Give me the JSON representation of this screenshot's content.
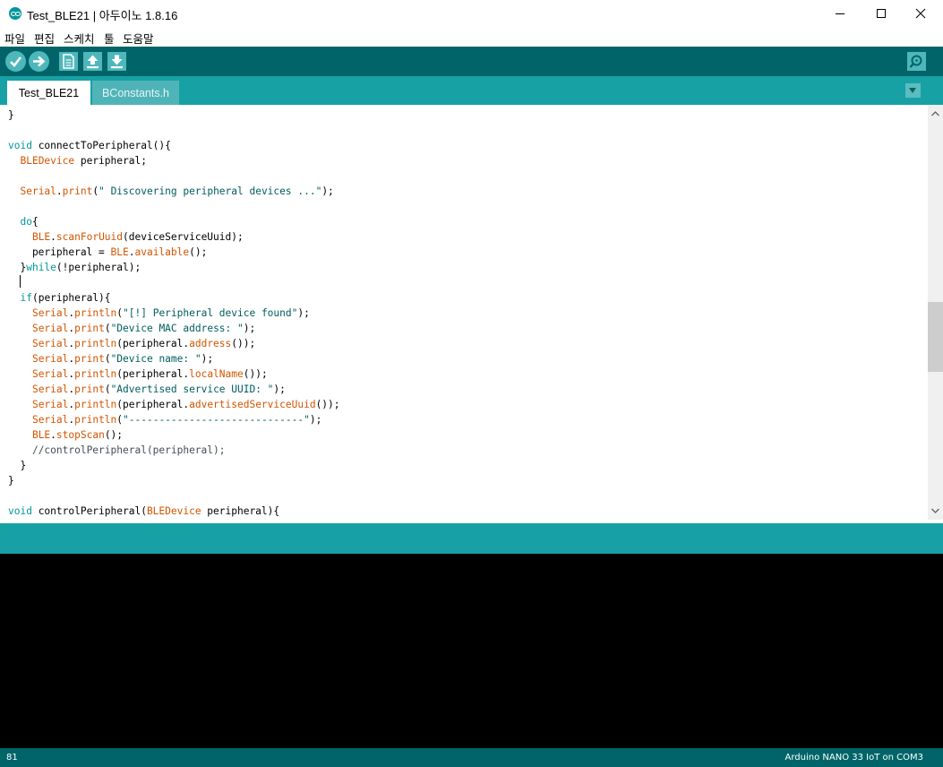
{
  "window": {
    "title": "Test_BLE21 | 아두이노 1.8.16",
    "icons": {
      "app": "arduino-logo-icon",
      "minimize": "minimize-icon",
      "maximize": "maximize-icon",
      "close": "close-icon"
    }
  },
  "menu": {
    "items": [
      "파일",
      "편집",
      "스케치",
      "툴",
      "도움말"
    ]
  },
  "toolbar": {
    "buttons": [
      "verify-icon",
      "upload-icon",
      "new-sketch-icon",
      "open-sketch-icon",
      "save-sketch-icon"
    ],
    "serial_monitor": "serial-monitor-icon"
  },
  "tabs": [
    {
      "label": "Test_BLE21",
      "active": true
    },
    {
      "label": "BConstants.h",
      "active": false
    }
  ],
  "editor": {
    "lines": [
      "}",
      "",
      "void connectToPeripheral(){",
      "  BLEDevice peripheral;",
      "",
      "  Serial.print(\" Discovering peripheral devices ...\");",
      "",
      "  do{",
      "    BLE.scanForUuid(deviceServiceUuid);",
      "    peripheral = BLE.available();",
      "  }while(!peripheral);",
      "  ",
      "  if(peripheral){",
      "    Serial.println(\"[!] Peripheral device found\");",
      "    Serial.print(\"Device MAC address: \");",
      "    Serial.println(peripheral.address());",
      "    Serial.print(\"Device name: \");",
      "    Serial.println(peripheral.localName());",
      "    Serial.print(\"Advertised service UUID: \");",
      "    Serial.println(peripheral.advertisedServiceUuid());",
      "    Serial.println(\"-----------------------------\");",
      "    BLE.stopScan();",
      "    //controlPeripheral(peripheral);",
      "  }",
      "}",
      "",
      "void controlPeripheral(BLEDevice peripheral){"
    ]
  },
  "status": {
    "line": "81",
    "board": "Arduino NANO 33 IoT on COM3"
  },
  "colors": {
    "toolbar": "#006468",
    "tabbar": "#17a1a5",
    "keyword": "#00979c",
    "type": "#d35400",
    "console": "#000000"
  }
}
